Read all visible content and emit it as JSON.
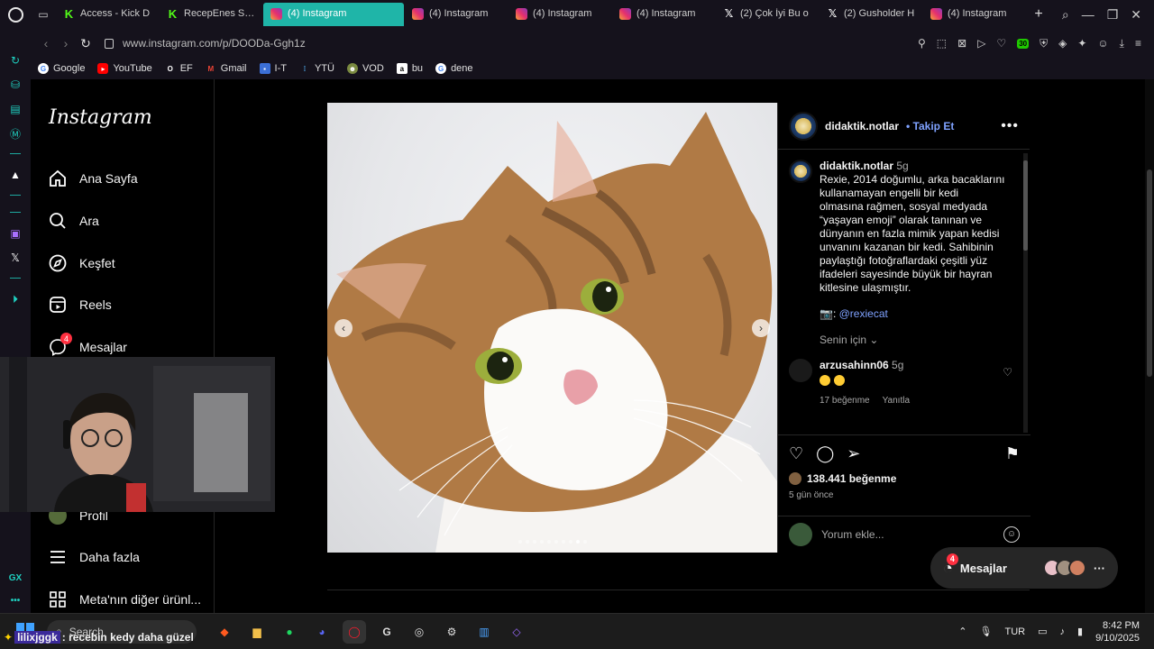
{
  "tabs": [
    {
      "label": "Access - Kick D",
      "type": "kick"
    },
    {
      "label": "RecepEnes Stre",
      "type": "kick"
    },
    {
      "label": "(4) Instagram",
      "type": "ig",
      "active": true
    },
    {
      "label": "(4) Instagram",
      "type": "ig"
    },
    {
      "label": "(4) Instagram",
      "type": "ig"
    },
    {
      "label": "(4) Instagram",
      "type": "ig"
    },
    {
      "label": "(2) Çok İyi Bu o",
      "type": "x"
    },
    {
      "label": "(2) Gusholder H",
      "type": "x"
    },
    {
      "label": "(4) Instagram",
      "type": "ig"
    }
  ],
  "address": {
    "url": "www.instagram.com/p/DOODa-Ggh1z",
    "ext_badge": "30"
  },
  "bookmarks": [
    "Google",
    "YouTube",
    "EF",
    "Gmail",
    "I-T",
    "YTÜ",
    "VOD",
    "bu",
    "dene"
  ],
  "ig": {
    "logo": "Instagram",
    "nav": {
      "home": "Ana Sayfa",
      "search": "Ara",
      "explore": "Keşfet",
      "reels": "Reels",
      "messages": "Mesajlar",
      "messages_badge": "4",
      "profile": "Profil",
      "more": "Daha fazla",
      "meta": "Meta'nın diğer ürünl..."
    },
    "post": {
      "username": "didaktik.notlar",
      "follow": "• Takip Et",
      "caption_time": "5g",
      "caption": "Rexie, 2014 doğumlu, arka bacaklarını kullanamayan engelli bir kedi olmasına rağmen, sosyal medyada “yaşayan emoji” olarak tanınan ve dünyanın en fazla mimik yapan kedisi unvanını kazanan bir kedi. Sahibinin paylaştığı fotoğraflardaki çeşitli yüz ifadeleri sayesinde büyük bir hayran kitlesine ulaşmıştır.",
      "credit_prefix": "📷:",
      "credit_mention": "@rexiecat",
      "for_you": "Senin için",
      "comment_user": "arzusahinn06",
      "comment_time": "5g",
      "comment_likes": "17 beğenme",
      "comment_reply": "Yanıtla",
      "likes": "138.441 beğenme",
      "ago": "5 gün önce",
      "add_comment": "Yorum ekle..."
    },
    "messages_pill": {
      "label": "Mesajlar",
      "badge": "4"
    }
  },
  "taskbar": {
    "search": "Search",
    "chat_user": "lilixjggk",
    "chat_text": ": recebin kedy daha güzel",
    "lang": "TUR",
    "time": "8:42 PM",
    "date": "9/10/2025"
  }
}
